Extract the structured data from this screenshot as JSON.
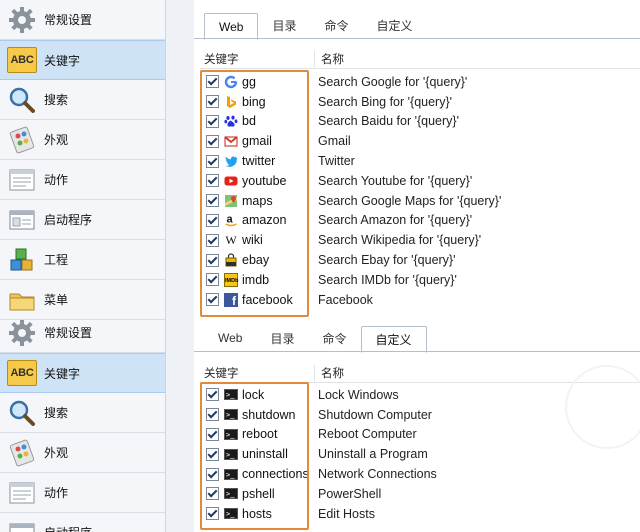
{
  "sidebar": {
    "items": [
      {
        "label": "常规设置",
        "icon": "gear-icon"
      },
      {
        "label": "关键字",
        "icon": "abc-icon",
        "icon_text": "ABC",
        "active": true
      },
      {
        "label": "搜索",
        "icon": "magnifier-icon"
      },
      {
        "label": "外观",
        "icon": "appearance-icon"
      },
      {
        "label": "动作",
        "icon": "action-list-icon"
      },
      {
        "label": "启动程序",
        "icon": "launcher-window-icon"
      },
      {
        "label": "工程",
        "icon": "blocks-icon"
      },
      {
        "label": "菜单",
        "icon": "folder-icon"
      },
      {
        "label": "常规设置",
        "icon": "gear-icon"
      },
      {
        "label": "关键字",
        "icon": "abc-icon",
        "icon_text": "ABC",
        "active": true
      },
      {
        "label": "搜索",
        "icon": "magnifier-icon"
      },
      {
        "label": "外观",
        "icon": "appearance-icon"
      },
      {
        "label": "动作",
        "icon": "action-list-icon"
      },
      {
        "label": "启动程序",
        "icon": "launcher-window-icon"
      }
    ]
  },
  "top_panel": {
    "tabs": [
      {
        "label": "Web",
        "active": true
      },
      {
        "label": "目录"
      },
      {
        "label": "命令"
      },
      {
        "label": "自定义"
      }
    ],
    "columns": {
      "keyword": "关键字",
      "name": "名称"
    },
    "rows": [
      {
        "keyword": "gg",
        "name": "Search Google for '{query}'",
        "icon": "google-icon"
      },
      {
        "keyword": "bing",
        "name": "Search Bing for '{query}'",
        "icon": "bing-icon"
      },
      {
        "keyword": "bd",
        "name": "Search Baidu for '{query}'",
        "icon": "baidu-paw-icon"
      },
      {
        "keyword": "gmail",
        "name": "Gmail",
        "icon": "gmail-icon"
      },
      {
        "keyword": "twitter",
        "name": "Twitter",
        "icon": "twitter-bird-icon"
      },
      {
        "keyword": "youtube",
        "name": "Search Youtube for '{query}'",
        "icon": "youtube-icon"
      },
      {
        "keyword": "maps",
        "name": "Search Google Maps for '{query}'",
        "icon": "maps-icon"
      },
      {
        "keyword": "amazon",
        "name": "Search Amazon for '{query}'",
        "icon": "amazon-icon"
      },
      {
        "keyword": "wiki",
        "name": "Search Wikipedia for '{query}'",
        "icon": "wikipedia-icon",
        "icon_text": "W"
      },
      {
        "keyword": "ebay",
        "name": "Search Ebay for '{query}'",
        "icon": "ebay-bag-icon"
      },
      {
        "keyword": "imdb",
        "name": "Search IMDb for '{query}'",
        "icon": "imdb-icon",
        "icon_text": "IMDb"
      },
      {
        "keyword": "facebook",
        "name": "Facebook",
        "icon": "facebook-icon",
        "icon_text": "f"
      }
    ]
  },
  "bottom_panel": {
    "tabs": [
      {
        "label": "Web"
      },
      {
        "label": "目录"
      },
      {
        "label": "命令"
      },
      {
        "label": "自定义",
        "active": true
      }
    ],
    "columns": {
      "keyword": "关键字",
      "name": "名称"
    },
    "rows": [
      {
        "keyword": "lock",
        "name": "Lock Windows",
        "icon": "terminal-icon"
      },
      {
        "keyword": "shutdown",
        "name": "Shutdown Computer",
        "icon": "terminal-icon"
      },
      {
        "keyword": "reboot",
        "name": "Reboot Computer",
        "icon": "terminal-icon"
      },
      {
        "keyword": "uninstall",
        "name": "Uninstall a Program",
        "icon": "terminal-icon"
      },
      {
        "keyword": "connections",
        "name": "Network Connections",
        "icon": "terminal-icon"
      },
      {
        "keyword": "pshell",
        "name": "PowerShell",
        "icon": "terminal-icon"
      },
      {
        "keyword": "hosts",
        "name": "Edit Hosts",
        "icon": "terminal-icon"
      }
    ]
  },
  "colors": {
    "highlight_box": "#e08a3a",
    "active_sidebar": "#cfe3f7"
  }
}
